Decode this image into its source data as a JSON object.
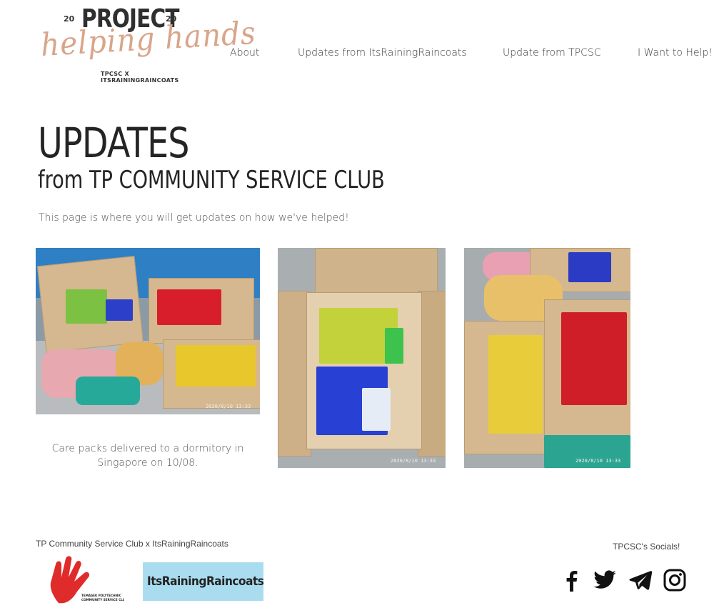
{
  "logo": {
    "year_left": "20",
    "project": "PROJECT",
    "year_right": "20",
    "script": "helping hands",
    "subtitle": "TPCSC X ITSRAININGRAINCOATS"
  },
  "nav": {
    "items": [
      {
        "label": "About"
      },
      {
        "label": "Updates from ItsRainingRaincoats"
      },
      {
        "label": "Update from TPCSC"
      },
      {
        "label": "I Want to Help!"
      }
    ]
  },
  "main": {
    "title": "UPDATES",
    "subtitle": "from TP COMMUNITY SERVICE CLUB",
    "intro": "This page is where you will get updates on how we've helped!",
    "gallery": {
      "caption": "Care packs delivered to a dormitory in Singapore on 10/08.",
      "photos": [
        {
          "stamp": "2020/8/10  13:33"
        },
        {
          "stamp": "2020/8/10  13:33"
        },
        {
          "stamp": "2020/8/10  13:33"
        }
      ]
    }
  },
  "footer": {
    "credit": "TP Community Service Club x ItsRainingRaincoats",
    "socials_label": "TPCSC's Socials!",
    "tp_logo_text": "TEMASEK POLYTECHNIC COMMUNITY SERVICE CLUB",
    "irr_logo_text": "ItsRainingRaincoats",
    "social_icons": [
      "facebook-icon",
      "twitter-icon",
      "telegram-icon",
      "instagram-icon"
    ]
  },
  "colors": {
    "accent_script": "#d9a58a",
    "text_dark": "#242424",
    "irr_logo_bg": "#a9dcef",
    "tp_logo_red": "#e02b2b"
  }
}
